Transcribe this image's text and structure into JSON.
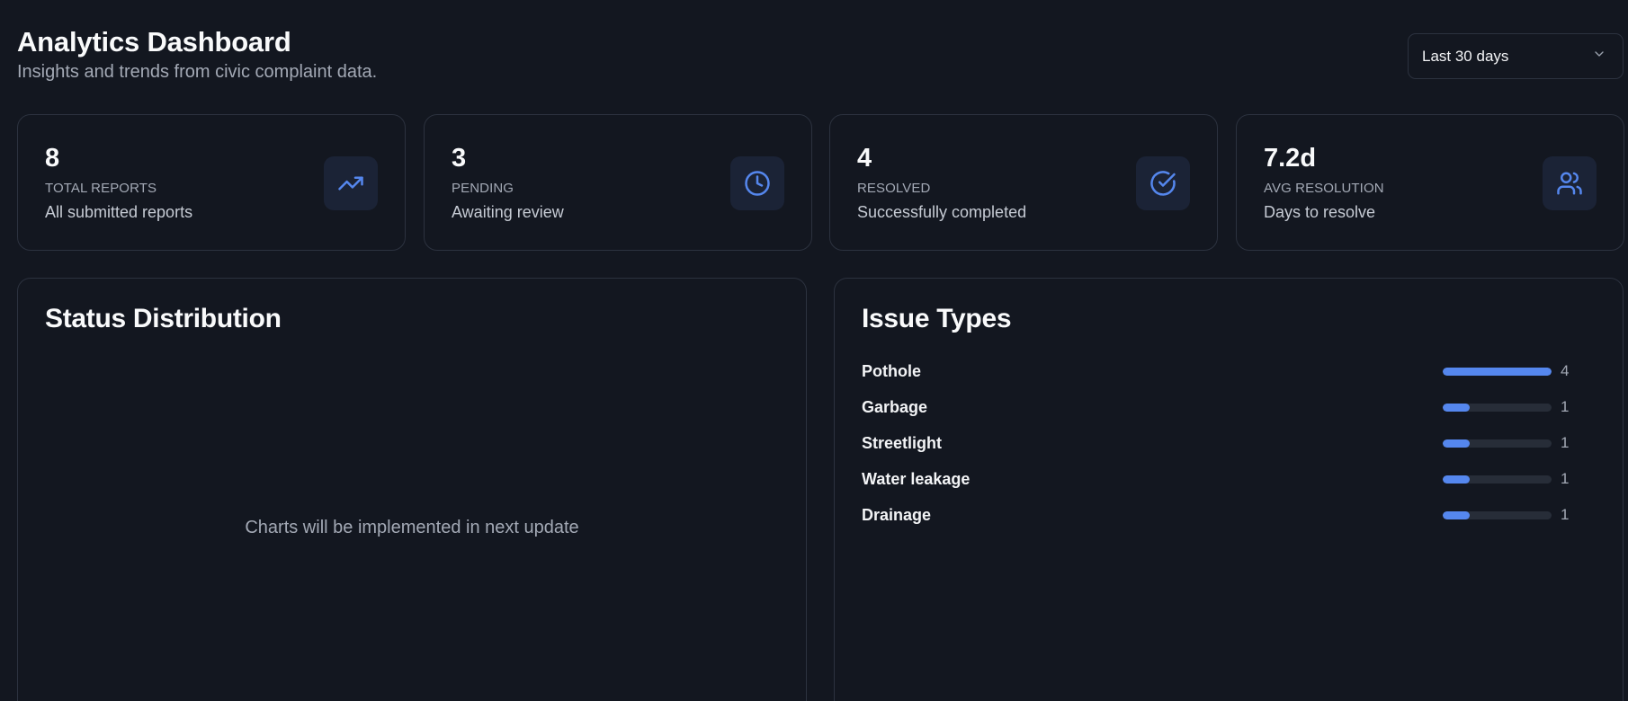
{
  "header": {
    "title": "Analytics Dashboard",
    "subtitle": "Insights and trends from civic complaint data."
  },
  "range_select": {
    "selected": "Last 30 days",
    "icon": "chevron-down-icon"
  },
  "stats": [
    {
      "value": "8",
      "label": "TOTAL REPORTS",
      "desc": "All submitted reports",
      "icon": "trending-up-icon"
    },
    {
      "value": "3",
      "label": "PENDING",
      "desc": "Awaiting review",
      "icon": "clock-icon"
    },
    {
      "value": "4",
      "label": "RESOLVED",
      "desc": "Successfully completed",
      "icon": "check-circle-icon"
    },
    {
      "value": "7.2d",
      "label": "AVG RESOLUTION",
      "desc": "Days to resolve",
      "icon": "users-icon"
    }
  ],
  "status_panel": {
    "title": "Status Distribution",
    "placeholder": "Charts will be implemented in next update"
  },
  "issue_panel": {
    "title": "Issue Types",
    "max": 4,
    "items": [
      {
        "name": "Pothole",
        "count": 4
      },
      {
        "name": "Garbage",
        "count": 1
      },
      {
        "name": "Streetlight",
        "count": 1
      },
      {
        "name": "Water leakage",
        "count": 1
      },
      {
        "name": "Drainage",
        "count": 1
      }
    ]
  },
  "colors": {
    "background": "#131720",
    "accent": "#5587ee",
    "icon_box": "#1b2336",
    "border": "#2c323f"
  }
}
